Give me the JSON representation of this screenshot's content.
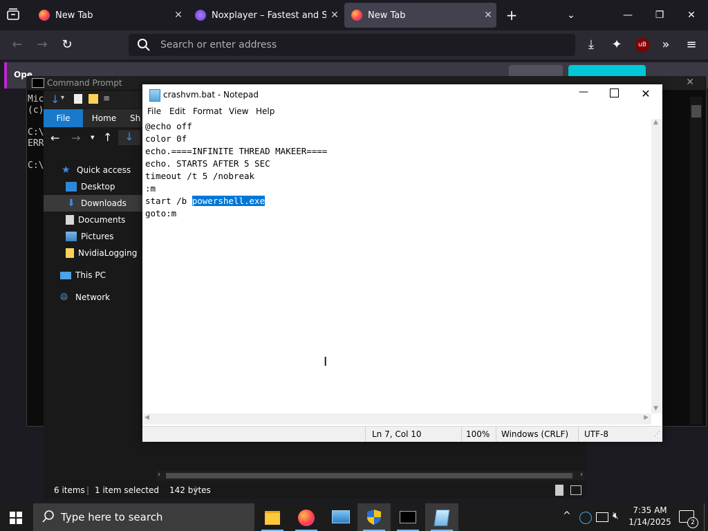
{
  "browser": {
    "tabs": [
      {
        "title": "New Tab",
        "active": false
      },
      {
        "title": "Noxplayer – Fastest and Smoot",
        "active": false
      },
      {
        "title": "New Tab",
        "active": true
      }
    ],
    "address_placeholder": "Search or enter address",
    "notification_partial": "Ope"
  },
  "cmd": {
    "title": "Command Prompt",
    "lines": [
      "Mic",
      "(c)",
      "",
      "C:\\",
      "ERR",
      "",
      "C:\\"
    ]
  },
  "explorer": {
    "tabs": {
      "file": "File",
      "home": "Home",
      "share": "Sh"
    },
    "nav": [
      {
        "label": "Quick access",
        "icon": "star-icon"
      },
      {
        "label": "Desktop",
        "icon": "desktop-folder-icon"
      },
      {
        "label": "Downloads",
        "icon": "downloads-folder-icon",
        "selected": true
      },
      {
        "label": "Documents",
        "icon": "documents-folder-icon"
      },
      {
        "label": "Pictures",
        "icon": "pictures-folder-icon"
      },
      {
        "label": "NvidiaLogging",
        "icon": "folder-icon"
      },
      {
        "label": "This PC",
        "icon": "computer-icon"
      },
      {
        "label": "Network",
        "icon": "network-icon"
      }
    ],
    "status": {
      "items": "6 items",
      "selected": "1 item selected",
      "size": "142 bytes"
    }
  },
  "notepad": {
    "title": "crashvm.bat - Notepad",
    "menu": [
      "File",
      "Edit",
      "Format",
      "View",
      "Help"
    ],
    "lines": [
      "@echo off",
      "color 0f",
      "echo.====INFINITE THREAD MAKEER====",
      "echo. STARTS AFTER 5 SEC",
      "timeout /t 5 /nobreak",
      ":m",
      "start /b ",
      "goto:m"
    ],
    "selection": "powershell.exe",
    "status": {
      "position": "Ln 7, Col 10",
      "zoom": "100%",
      "line_ending": "Windows (CRLF)",
      "encoding": "UTF-8"
    }
  },
  "taskbar": {
    "search_placeholder": "Type here to search",
    "time": "7:35 AM",
    "date": "1/14/2025",
    "notification_count": "2"
  }
}
